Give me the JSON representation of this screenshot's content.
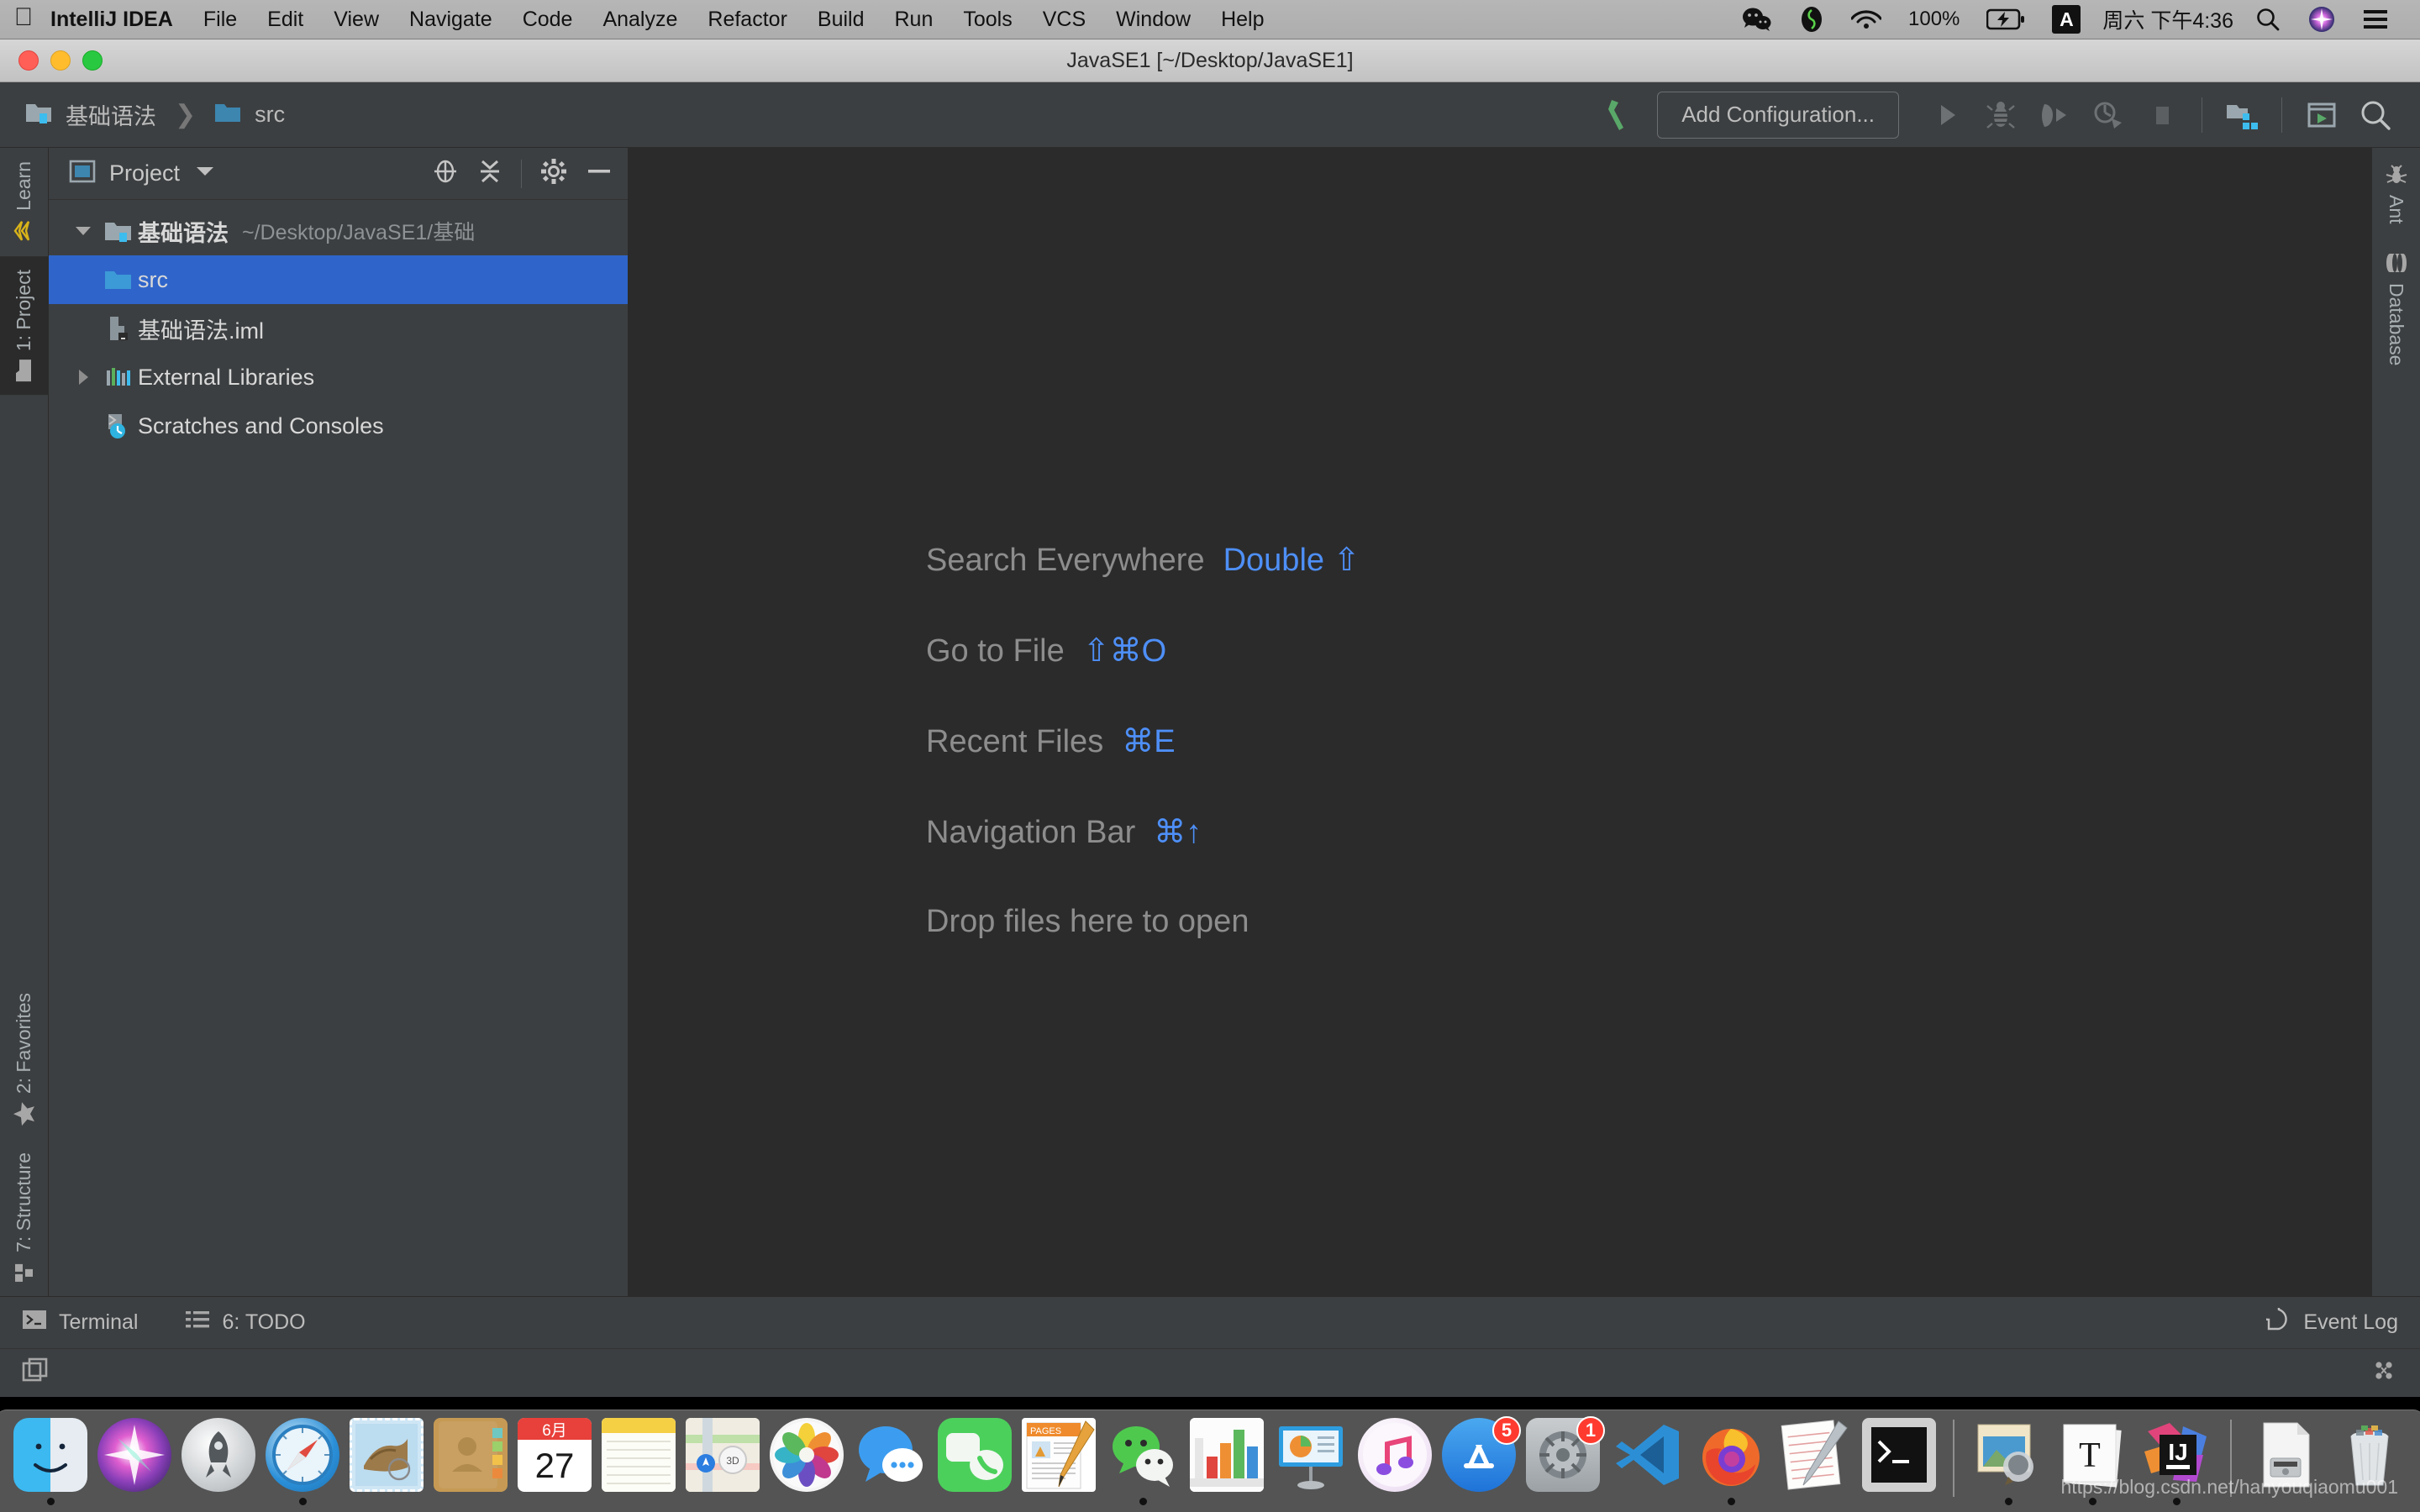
{
  "menubar": {
    "apple_icon": "apple-logo-icon",
    "app_name": "IntelliJ IDEA",
    "items": [
      "File",
      "Edit",
      "View",
      "Navigate",
      "Code",
      "Analyze",
      "Refactor",
      "Build",
      "Run",
      "Tools",
      "VCS",
      "Window",
      "Help"
    ],
    "status": {
      "wechat_icon": "wechat-icon",
      "evernote_icon": "evernote-icon",
      "wifi_icon": "wifi-icon",
      "battery_percent": "100%",
      "battery_icon": "battery-charging-icon",
      "input_method": "A",
      "clock": "周六 下午4:36",
      "search_icon": "spotlight-search-icon",
      "siri_icon": "siri-icon",
      "control_center_icon": "control-center-icon"
    }
  },
  "window": {
    "title": "JavaSE1 [~/Desktop/JavaSE1]",
    "close_label": "close",
    "minimize_label": "minimize",
    "zoom_label": "zoom"
  },
  "toolbar": {
    "breadcrumb": [
      {
        "label": "基础语法",
        "icon": "module-folder-icon"
      },
      {
        "label": "src",
        "icon": "source-folder-icon"
      }
    ],
    "separator": "❯",
    "build_icon": "build-hammer-icon",
    "add_configuration": "Add Configuration...",
    "run_icon": "run-icon",
    "debug_icon": "debug-bug-icon",
    "run_coverage_icon": "run-with-coverage-icon",
    "profile_icon": "profiler-icon",
    "stop_icon": "stop-icon",
    "project_structure_icon": "project-structure-icon",
    "run_anything_icon": "run-anything-icon",
    "search_everywhere_icon": "search-everywhere-icon"
  },
  "left_bar": {
    "top_tabs": [
      {
        "label": "Learn",
        "icon": "learn-chevron-icon",
        "active": false
      },
      {
        "label": "1: Project",
        "icon": "project-folder-icon",
        "active": true,
        "mnemonic": "1"
      }
    ],
    "bottom_tabs": [
      {
        "label": "2: Favorites",
        "icon": "favorites-star-icon",
        "mnemonic": "2"
      },
      {
        "label": "7: Structure",
        "icon": "structure-blocks-icon",
        "mnemonic": "7"
      }
    ]
  },
  "right_bar": {
    "tabs": [
      {
        "label": "Ant",
        "icon": "ant-icon"
      },
      {
        "label": "Database",
        "icon": "database-cylinder-icon"
      }
    ]
  },
  "project_panel": {
    "title": "Project",
    "view_icon": "project-view-icon",
    "dropdown_icon": "chevron-down-icon",
    "locate_icon": "scroll-from-source-icon",
    "collapse_icon": "collapse-all-icon",
    "settings_icon": "gear-icon",
    "hide_icon": "hide-panel-icon",
    "tree": [
      {
        "label": "基础语法",
        "path": "~/Desktop/JavaSE1/基础",
        "icon": "module-folder-icon",
        "arrow": "expanded",
        "indent": 0,
        "selected": false,
        "bold": true
      },
      {
        "label": "src",
        "path": "",
        "icon": "source-root-folder-icon",
        "arrow": "none",
        "indent": 1,
        "selected": true,
        "bold": false
      },
      {
        "label": "基础语法.iml",
        "path": "",
        "icon": "iml-file-icon",
        "arrow": "none",
        "indent": 1,
        "selected": false,
        "bold": false
      },
      {
        "label": "External Libraries",
        "path": "",
        "icon": "external-libraries-icon",
        "arrow": "collapsed",
        "indent": 0,
        "selected": false,
        "bold": false
      },
      {
        "label": "Scratches and Consoles",
        "path": "",
        "icon": "scratches-consoles-icon",
        "arrow": "none",
        "indent": 0,
        "selected": false,
        "bold": false
      }
    ]
  },
  "editor": {
    "hints": [
      {
        "action": "Search Everywhere",
        "shortcut": "Double ⇧"
      },
      {
        "action": "Go to File",
        "shortcut": "⇧⌘O"
      },
      {
        "action": "Recent Files",
        "shortcut": "⌘E"
      },
      {
        "action": "Navigation Bar",
        "shortcut": "⌘↑"
      },
      {
        "action": "Drop files here to open",
        "shortcut": ""
      }
    ]
  },
  "status_bar": {
    "terminal": {
      "label": "Terminal",
      "icon": "terminal-icon"
    },
    "todo": {
      "label": "6: TODO",
      "icon": "todo-list-icon",
      "mnemonic": "6"
    },
    "event_log": {
      "label": "Event Log",
      "icon": "event-log-icon"
    },
    "restore_layout_icon": "restore-layout-icon",
    "inspection_icon": "inspections-widget-icon"
  },
  "dock": {
    "apps": [
      {
        "name": "Finder",
        "icon": "finder-icon",
        "running": true,
        "badge": ""
      },
      {
        "name": "Siri",
        "icon": "siri-icon",
        "running": false,
        "badge": ""
      },
      {
        "name": "Launchpad",
        "icon": "launchpad-icon",
        "running": false,
        "badge": ""
      },
      {
        "name": "Safari",
        "icon": "safari-icon",
        "running": true,
        "badge": ""
      },
      {
        "name": "Mail",
        "icon": "mail-icon",
        "running": false,
        "badge": ""
      },
      {
        "name": "Contacts",
        "icon": "contacts-icon",
        "running": false,
        "badge": ""
      },
      {
        "name": "Calendar",
        "icon": "calendar-icon",
        "running": false,
        "badge": "",
        "month": "6月",
        "day": "27"
      },
      {
        "name": "Notes",
        "icon": "notes-icon",
        "running": false,
        "badge": ""
      },
      {
        "name": "Maps",
        "icon": "maps-icon",
        "running": false,
        "badge": ""
      },
      {
        "name": "Photos",
        "icon": "photos-icon",
        "running": false,
        "badge": ""
      },
      {
        "name": "Messages",
        "icon": "messages-icon",
        "running": false,
        "badge": ""
      },
      {
        "name": "FaceTime",
        "icon": "facetime-icon",
        "running": false,
        "badge": ""
      },
      {
        "name": "Pages",
        "icon": "pages-icon",
        "running": false,
        "badge": ""
      },
      {
        "name": "WeChat",
        "icon": "wechat-icon",
        "running": true,
        "badge": ""
      },
      {
        "name": "Numbers",
        "icon": "numbers-icon",
        "running": false,
        "badge": ""
      },
      {
        "name": "Keynote",
        "icon": "keynote-icon",
        "running": false,
        "badge": ""
      },
      {
        "name": "iTunes",
        "icon": "itunes-icon",
        "running": false,
        "badge": ""
      },
      {
        "name": "App Store",
        "icon": "app-store-icon",
        "running": false,
        "badge": "5"
      },
      {
        "name": "System Preferences",
        "icon": "system-preferences-icon",
        "running": false,
        "badge": "1"
      },
      {
        "name": "Visual Studio Code",
        "icon": "vscode-icon",
        "running": false,
        "badge": ""
      },
      {
        "name": "Firefox",
        "icon": "firefox-icon",
        "running": true,
        "badge": ""
      },
      {
        "name": "TextEdit",
        "icon": "textedit-icon",
        "running": false,
        "badge": ""
      },
      {
        "name": "Terminal",
        "icon": "terminal-icon",
        "running": false,
        "badge": ""
      }
    ],
    "apps_right": [
      {
        "name": "Preview",
        "icon": "preview-icon",
        "running": true,
        "badge": ""
      },
      {
        "name": "Typora",
        "icon": "typora-icon",
        "running": false,
        "badge": ""
      },
      {
        "name": "IntelliJ IDEA",
        "icon": "intellij-idea-icon",
        "running": true,
        "badge": ""
      }
    ],
    "apps_far_right": [
      {
        "name": "Downloads",
        "icon": "downloads-stack-icon",
        "running": false,
        "badge": ""
      },
      {
        "name": "Trash",
        "icon": "trash-icon",
        "running": false,
        "badge": ""
      }
    ]
  },
  "watermark": "https://blog.csdn.net/hanyouqiaomu001",
  "colors": {
    "ide_bg": "#3c3f41",
    "editor_bg": "#2b2b2b",
    "selection_blue": "#2f65ca",
    "accent_blue": "#4e8ff7",
    "text_primary": "#d8d8d8",
    "text_muted": "#8d8d8d",
    "build_green": "#4caf50"
  }
}
